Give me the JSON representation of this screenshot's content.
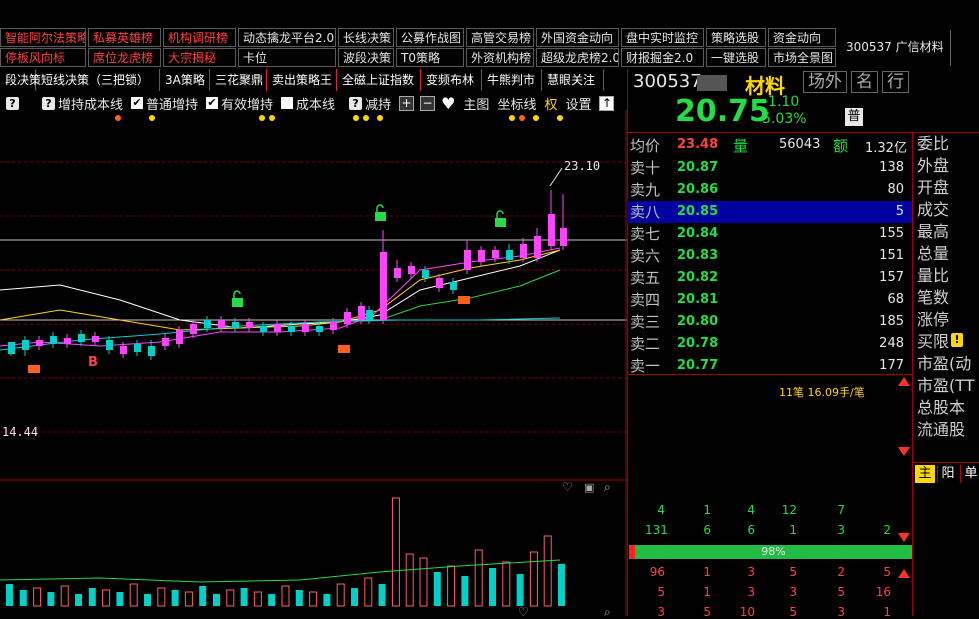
{
  "toolbar_row1": [
    {
      "label": "智能阿尔法策略",
      "color": "red"
    },
    {
      "label": "私募英雄榜",
      "color": "red"
    },
    {
      "label": "机构调研榜",
      "color": "red"
    },
    {
      "label": "动态擒龙平台2.0",
      "color": "white"
    },
    {
      "label": "长线决策",
      "color": "white"
    },
    {
      "label": "公募作战图",
      "color": "white"
    },
    {
      "label": "高管交易榜",
      "color": "white"
    },
    {
      "label": "外国资金动向",
      "color": "white"
    },
    {
      "label": "盘中实时监控",
      "color": "white"
    },
    {
      "label": "策略选股",
      "color": "white"
    },
    {
      "label": "资金动向",
      "color": "white"
    }
  ],
  "toolbar_row2": [
    {
      "label": "停板风向标",
      "color": "red"
    },
    {
      "label": "席位龙虎榜",
      "color": "red"
    },
    {
      "label": "大宗揭秘",
      "color": "red"
    },
    {
      "label": "卡位",
      "color": "white"
    },
    {
      "label": "波段决策",
      "color": "white"
    },
    {
      "label": "T0策略",
      "color": "white"
    },
    {
      "label": "外资机构榜",
      "color": "white"
    },
    {
      "label": "超级龙虎榜2.0",
      "color": "white"
    },
    {
      "label": "财报掘金2.0",
      "color": "white"
    },
    {
      "label": "一键选股",
      "color": "white"
    },
    {
      "label": "市场全景图",
      "color": "white"
    }
  ],
  "stock_code_label": "300537 广信材料",
  "tabs": [
    "段决策",
    "短线决策（三把锁）",
    "3A策略",
    "三花聚鼎",
    "卖出策略王",
    "全磁上证指数",
    "变频布林",
    "牛熊判市",
    "慧眼关注"
  ],
  "indicators": [
    {
      "label": "",
      "type": "q"
    },
    {
      "label": "增持成本线",
      "type": "q"
    },
    {
      "label": "普通增持",
      "type": "check"
    },
    {
      "label": "有效增持",
      "type": "check"
    },
    {
      "label": "成本线",
      "type": "box"
    },
    {
      "label": "减持",
      "type": "q"
    }
  ],
  "controls": {
    "main_chart": "主图",
    "coord_line": "坐标线",
    "right": "权",
    "settings": "设置"
  },
  "chart_labels": {
    "high": "23.10",
    "low": "14.44",
    "b_marker": "B"
  },
  "stock": {
    "code": "300537",
    "name": "材料",
    "tabs": [
      "场外",
      "名",
      "行"
    ],
    "price": "20.75",
    "change": "-1.10",
    "change_pct": "-5.03%",
    "badge": "普"
  },
  "summary": {
    "avg_label": "均价",
    "avg": "23.48",
    "vol_label": "量",
    "vol": "56043",
    "amt_label": "额",
    "amt": "1.32亿"
  },
  "order_book": [
    {
      "label": "卖十",
      "price": "20.87",
      "vol": "138"
    },
    {
      "label": "卖九",
      "price": "20.86",
      "vol": "80"
    },
    {
      "label": "卖八",
      "price": "20.85",
      "vol": "5"
    },
    {
      "label": "卖七",
      "price": "20.84",
      "vol": "155"
    },
    {
      "label": "卖六",
      "price": "20.83",
      "vol": "151"
    },
    {
      "label": "卖五",
      "price": "20.82",
      "vol": "157"
    },
    {
      "label": "卖四",
      "price": "20.81",
      "vol": "68"
    },
    {
      "label": "卖三",
      "price": "20.80",
      "vol": "185"
    },
    {
      "label": "卖二",
      "price": "20.78",
      "vol": "248"
    },
    {
      "label": "卖一",
      "price": "20.77",
      "vol": "177"
    }
  ],
  "side_labels": [
    "委比",
    "外盘",
    "开盘",
    "成交",
    "最高",
    "总量",
    "量比",
    "笔数",
    "涨停",
    "买限",
    "市盈(动",
    "市盈(TT",
    "总股本",
    "流通股"
  ],
  "trade_stats": "11笔 16.09手/笔",
  "bottom_tabs": [
    "主",
    "阳",
    "单"
  ],
  "grid_rows": [
    [
      "4",
      "1",
      "4",
      "12",
      "7",
      ""
    ],
    [
      "131",
      "6",
      "6",
      "1",
      "3",
      "2"
    ],
    [
      "96",
      "1",
      "3",
      "5",
      "2",
      "5"
    ],
    [
      "5",
      "1",
      "3",
      "3",
      "5",
      "16"
    ],
    [
      "3",
      "5",
      "10",
      "5",
      "3",
      "1"
    ]
  ],
  "ratio_bar": "98%",
  "colors": {
    "up": "#ff44ff",
    "down": "#00d0c8",
    "green_price": "#22dd44",
    "red": "#ff4040",
    "highlight": "#0000a0"
  }
}
